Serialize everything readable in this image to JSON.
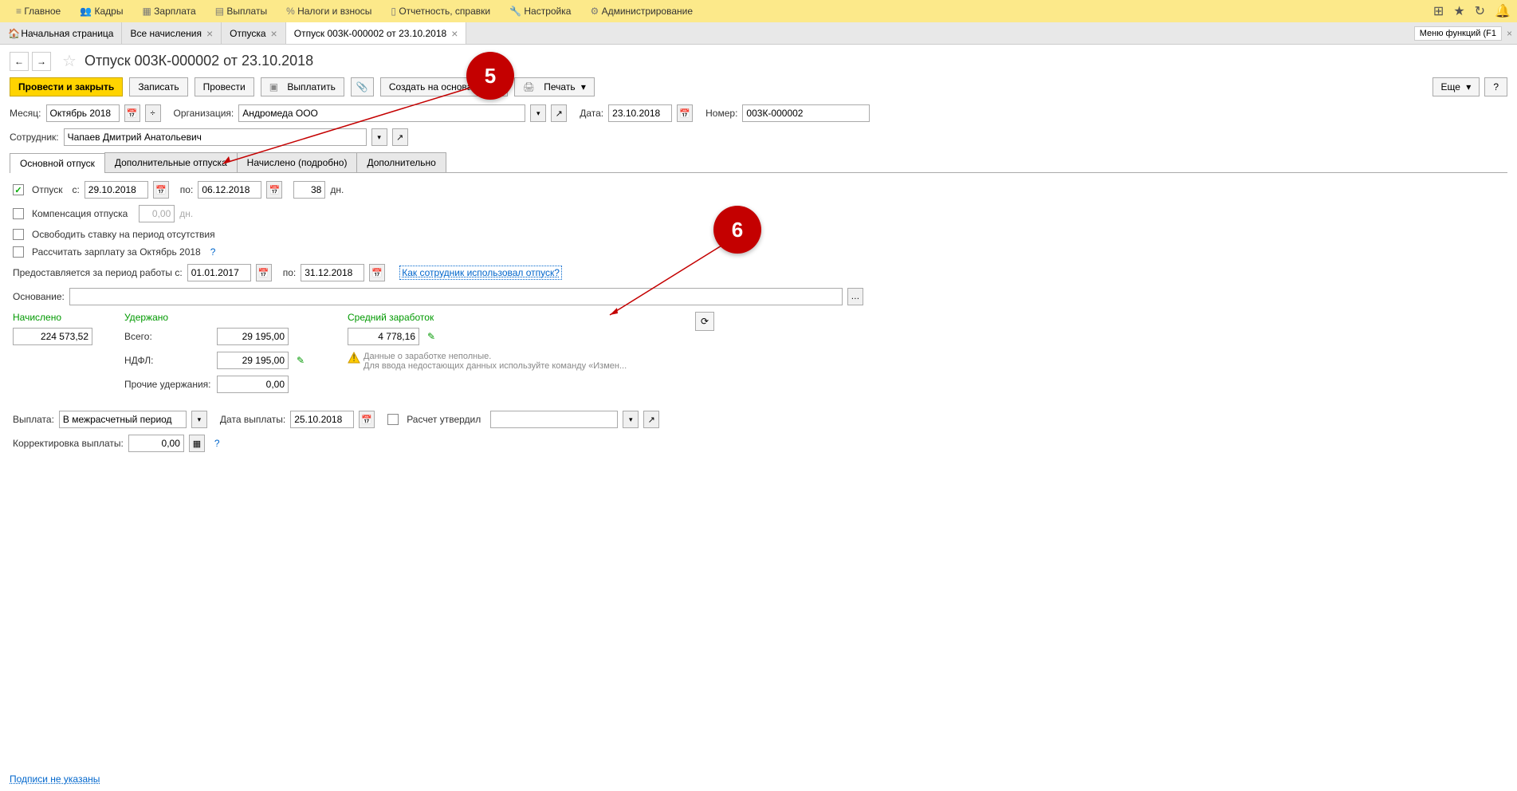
{
  "topMenu": {
    "main": "Главное",
    "hr": "Кадры",
    "salary": "Зарплата",
    "payments": "Выплаты",
    "taxes": "Налоги и взносы",
    "reports": "Отчетность, справки",
    "settings": "Настройка",
    "admin": "Администрирование"
  },
  "tabs": {
    "home": "Начальная страница",
    "all": "Все начисления",
    "vacations": "Отпуска",
    "current": "Отпуск 003К-000002 от 23.10.2018",
    "menuFunctions": "Меню функций (F1"
  },
  "pageTitle": "Отпуск 003К-000002 от 23.10.2018",
  "toolbar": {
    "postClose": "Провести и закрыть",
    "save": "Записать",
    "post": "Провести",
    "pay": "Выплатить",
    "createBased": "Создать на основании",
    "print": "Печать",
    "more": "Еще",
    "help": "?"
  },
  "fields": {
    "monthLabel": "Месяц:",
    "monthValue": "Октябрь 2018",
    "orgLabel": "Организация:",
    "orgValue": "Андромеда ООО",
    "dateLabel": "Дата:",
    "dateValue": "23.10.2018",
    "numberLabel": "Номер:",
    "numberValue": "003К-000002",
    "employeeLabel": "Сотрудник:",
    "employeeValue": "Чапаев Дмитрий Анатольевич"
  },
  "innerTabs": {
    "main": "Основной отпуск",
    "additional": "Дополнительные отпуска",
    "accrued": "Начислено (подробно)",
    "extra": "Дополнительно"
  },
  "vacation": {
    "label": "Отпуск",
    "fromLabel": "с:",
    "fromValue": "29.10.2018",
    "toLabel": "по:",
    "toValue": "06.12.2018",
    "daysValue": "38",
    "daysLabel": "дн.",
    "compensationLabel": "Компенсация отпуска",
    "compensationValue": "0,00",
    "compensationDays": "дн.",
    "freeRateLabel": "Освободить ставку на период отсутствия",
    "calcSalaryLabel": "Рассчитать зарплату за Октябрь 2018",
    "periodLabel": "Предоставляется за период работы с:",
    "periodFrom": "01.01.2017",
    "periodToLabel": "по:",
    "periodTo": "31.12.2018",
    "usageLink": "Как сотрудник использовал отпуск?",
    "basisLabel": "Основание:"
  },
  "totals": {
    "accruedLabel": "Начислено",
    "accruedValue": "224 573,52",
    "withheldLabel": "Удержано",
    "totalLabel": "Всего:",
    "totalValue": "29 195,00",
    "ndflLabel": "НДФЛ:",
    "ndflValue": "29 195,00",
    "otherLabel": "Прочие удержания:",
    "otherValue": "0,00",
    "avgLabel": "Средний заработок",
    "avgValue": "4 778,16",
    "warnLine1": "Данные о заработке неполные.",
    "warnLine2": "Для ввода недостающих данных используйте команду «Измен..."
  },
  "payout": {
    "label": "Выплата:",
    "value": "В межрасчетный период",
    "dateLabel": "Дата выплаты:",
    "dateValue": "25.10.2018",
    "approvedLabel": "Расчет утвердил",
    "correctionLabel": "Корректировка выплаты:",
    "correctionValue": "0,00"
  },
  "footer": {
    "signatures": "Подписи не указаны"
  },
  "callouts": {
    "five": "5",
    "six": "6"
  }
}
